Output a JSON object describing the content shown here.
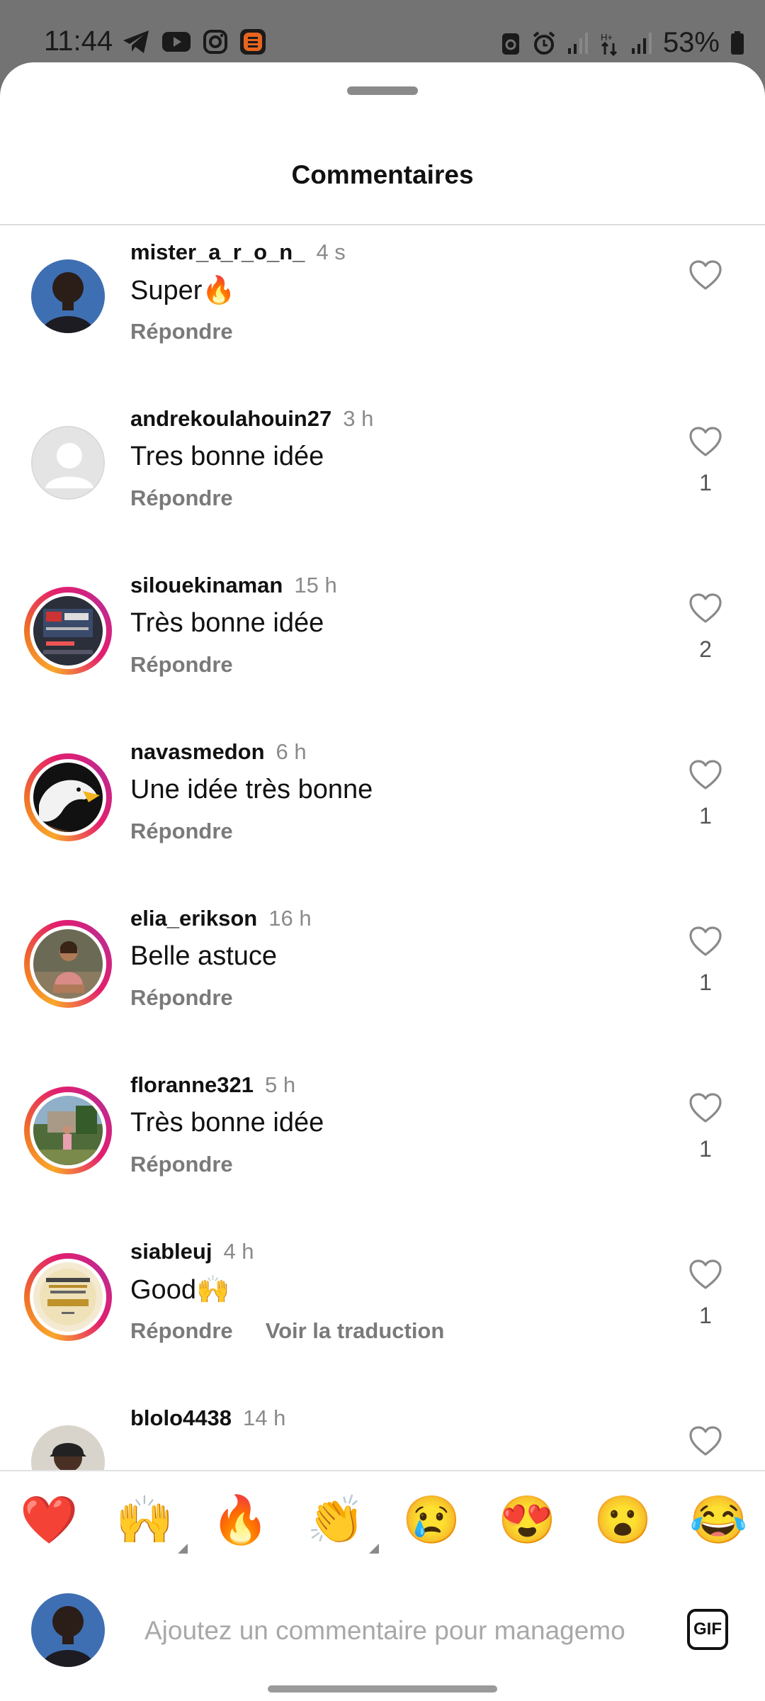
{
  "status_bar": {
    "time": "11:44",
    "left_icons": [
      "telegram-icon",
      "youtube-icon",
      "instagram-icon",
      "app-icon"
    ],
    "right_icons": [
      "recycle-icon",
      "alarm-icon",
      "signal-icon",
      "data-icon",
      "signal-icon"
    ],
    "battery": "53%"
  },
  "sheet": {
    "title": "Commentaires"
  },
  "comments": [
    {
      "username": "mister_a_r_o_n_",
      "ago": "4 s",
      "text": "Super🔥",
      "reply": "Répondre",
      "likes": "",
      "ring": false,
      "avatar": "man-portrait"
    },
    {
      "username": "andrekoulahouin27",
      "ago": "3 h",
      "text": "Tres bonne idée",
      "reply": "Répondre",
      "likes": "1",
      "ring": false,
      "avatar": "default"
    },
    {
      "username": "silouekinaman",
      "ago": "15 h",
      "text": "Très bonne idée",
      "reply": "Répondre",
      "likes": "2",
      "ring": true,
      "avatar": "screen-photo"
    },
    {
      "username": "navasmedon",
      "ago": "6 h",
      "text": "Une idée très bonne",
      "reply": "Répondre",
      "likes": "1",
      "ring": true,
      "avatar": "eagle"
    },
    {
      "username": "elia_erikson",
      "ago": "16 h",
      "text": "Belle astuce",
      "reply": "Répondre",
      "likes": "1",
      "ring": true,
      "avatar": "woman-sitting"
    },
    {
      "username": "floranne321",
      "ago": "5 h",
      "text": "Très bonne idée",
      "reply": "Répondre",
      "likes": "1",
      "ring": true,
      "avatar": "outdoor-photo"
    },
    {
      "username": "siableuj",
      "ago": "4 h",
      "text": "Good🙌",
      "reply": "Répondre",
      "translate": "Voir la traduction",
      "likes": "1",
      "ring": true,
      "avatar": "poster"
    },
    {
      "username": "blolo4438",
      "ago": "14 h",
      "text": "",
      "reply": "",
      "likes": "",
      "ring": false,
      "avatar": "man-cap"
    }
  ],
  "emoji_bar": [
    "❤️",
    "🙌",
    "🔥",
    "👏",
    "😢",
    "😍",
    "😮",
    "😂"
  ],
  "input": {
    "placeholder": "Ajoutez un commentaire pour managemo",
    "gif_label": "GIF"
  },
  "colors": {
    "ring_start": "#f9a72b",
    "ring_end": "#c1298f",
    "secondary_text": "#8a8a8a"
  }
}
